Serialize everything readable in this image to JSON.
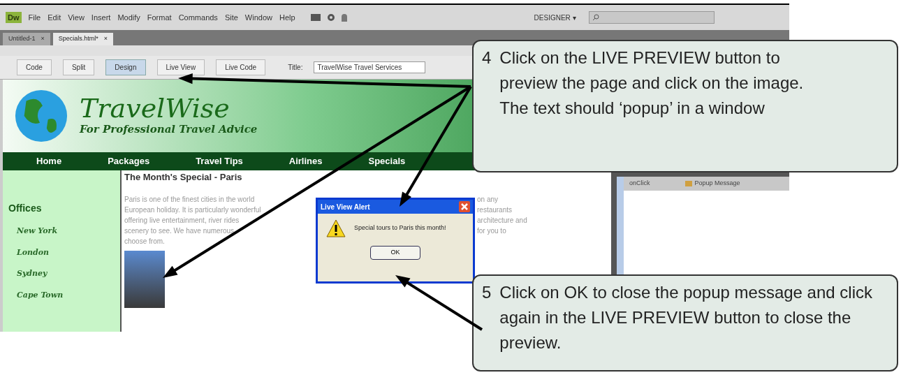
{
  "menubar": {
    "logo": "Dw",
    "items": [
      "File",
      "Edit",
      "View",
      "Insert",
      "Modify",
      "Format",
      "Commands",
      "Site",
      "Window",
      "Help"
    ],
    "workspace": "DESIGNER",
    "workspace_caret": "▾"
  },
  "tabs": [
    {
      "label": "Untitled-1",
      "close": "×",
      "selected": false
    },
    {
      "label": "Specials.html*",
      "close": "×",
      "selected": true
    }
  ],
  "toolbar": {
    "buttons": [
      {
        "label": "Code",
        "selected": false
      },
      {
        "label": "Split",
        "selected": false
      },
      {
        "label": "Design",
        "selected": true
      },
      {
        "label": "Live View",
        "selected": false
      },
      {
        "label": "Live Code",
        "selected": false
      }
    ],
    "title_label": "Title:",
    "title_value": "TravelWise Travel Services"
  },
  "site": {
    "logo": "TravelWise",
    "tagline": "For Professional Travel Advice",
    "nav": [
      "Home",
      "Packages",
      "Travel Tips",
      "Airlines",
      "Specials"
    ],
    "sidebar": {
      "heading": "Offices",
      "links": [
        "New York",
        "London",
        "Sydney",
        "Cape Town"
      ]
    },
    "heading": "The Month's Special - Paris",
    "body_left": [
      "Paris is one of the finest cities in the world",
      "European holiday. It is particularly wonderful",
      "offering live entertainment, river rides",
      "scenery to see. We have numerous",
      "choose from."
    ],
    "body_right": [
      "on any",
      "restaurants",
      "architecture and",
      "for you to"
    ]
  },
  "dialog": {
    "title": "Live View Alert",
    "message": "Special tours to Paris this month!",
    "button": "OK"
  },
  "behaviors": [
    {
      "event": "onClick",
      "action": "Popup Message"
    }
  ],
  "callouts": [
    {
      "number": "4",
      "text": "Click on the LIVE PREVIEW button to preview the page and click on the image.  The text should ‘popup’ in a window"
    },
    {
      "number": "5",
      "text": "Click on OK to close the popup message and click again in the LIVE PREVIEW button to close the preview."
    }
  ]
}
